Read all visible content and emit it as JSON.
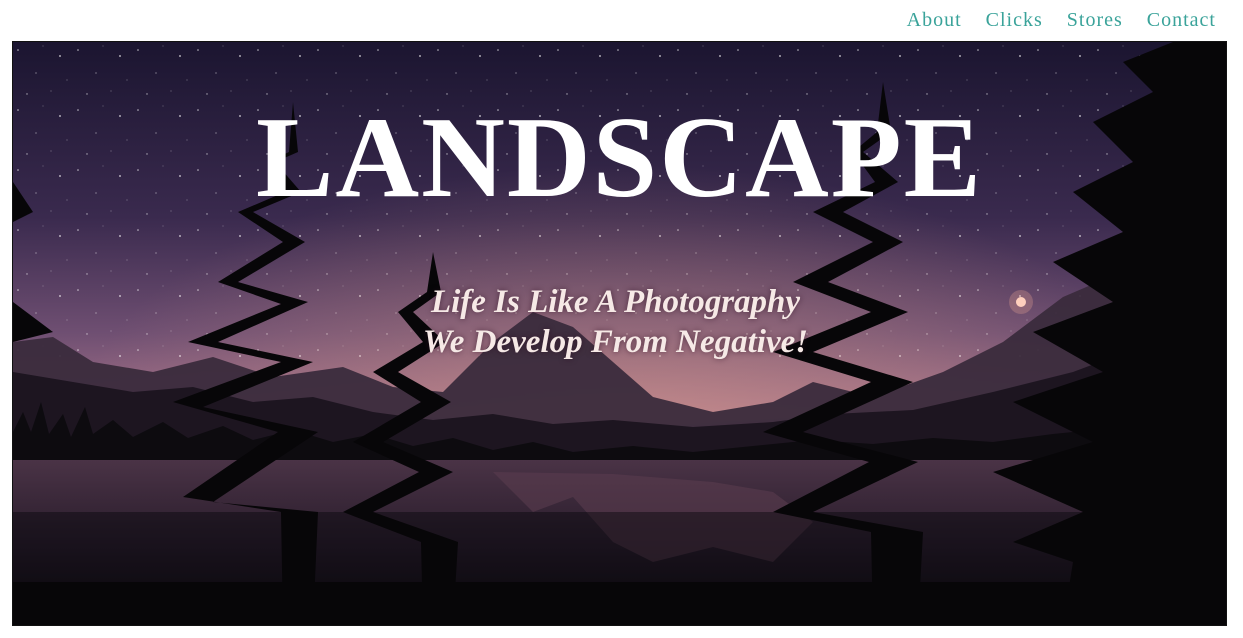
{
  "nav": {
    "items": [
      {
        "label": "About"
      },
      {
        "label": "Clicks"
      },
      {
        "label": "Stores"
      },
      {
        "label": "Contact"
      }
    ]
  },
  "hero": {
    "title": "LANDSCAPE",
    "tagline_line1": "Life Is Like A Photography",
    "tagline_line2": "We Develop From Negative!",
    "image": "night-sky-mountain-lake-with-pine-trees"
  },
  "colors": {
    "nav_link": "#3aa39a",
    "title": "#ffffff",
    "tagline": "#f6e9e6"
  }
}
